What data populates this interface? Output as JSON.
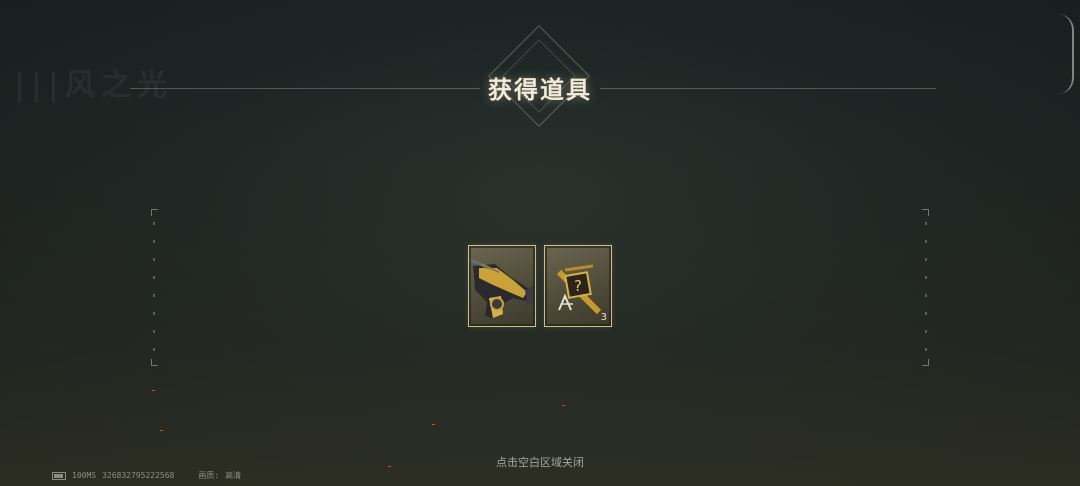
{
  "dialog": {
    "title": "获得道具",
    "close_hint": "点击空白区域关闭"
  },
  "items": [
    {
      "name": "golden-rifle",
      "count": ""
    },
    {
      "name": "mystery-weapon-box",
      "count": "3"
    }
  ],
  "status_bar": {
    "latency": "100MS",
    "player_id": "326832795222568",
    "quality_label": "画质:",
    "quality_value": "高清"
  },
  "colors": {
    "accent_gold": "#cbbf8a",
    "title_text": "#f2ead8"
  }
}
